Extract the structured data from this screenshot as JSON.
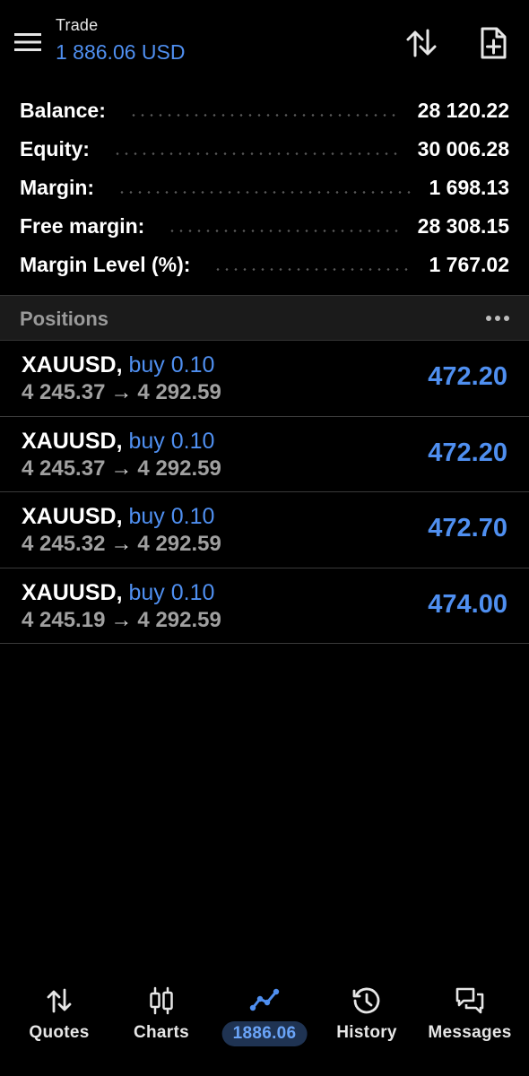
{
  "header": {
    "title": "Trade",
    "subtitle": "1 886.06 USD"
  },
  "summary": [
    {
      "label": "Balance:",
      "value": "28 120.22"
    },
    {
      "label": "Equity:",
      "value": "30 006.28"
    },
    {
      "label": "Margin:",
      "value": "1 698.13"
    },
    {
      "label": "Free margin:",
      "value": "28 308.15"
    },
    {
      "label": "Margin Level (%):",
      "value": "1 767.02"
    }
  ],
  "positions": {
    "title": "Positions",
    "items": [
      {
        "symbol": "XAUUSD,",
        "type": "buy 0.10",
        "open": "4 245.37",
        "arrow": "→",
        "current": "4 292.59",
        "profit": "472.20"
      },
      {
        "symbol": "XAUUSD,",
        "type": "buy 0.10",
        "open": "4 245.37",
        "arrow": "→",
        "current": "4 292.59",
        "profit": "472.20"
      },
      {
        "symbol": "XAUUSD,",
        "type": "buy 0.10",
        "open": "4 245.32",
        "arrow": "→",
        "current": "4 292.59",
        "profit": "472.70"
      },
      {
        "symbol": "XAUUSD,",
        "type": "buy 0.10",
        "open": "4 245.19",
        "arrow": "→",
        "current": "4 292.59",
        "profit": "474.00"
      }
    ]
  },
  "nav": {
    "quotes": "Quotes",
    "charts": "Charts",
    "trade": "1886.06",
    "history": "History",
    "messages": "Messages"
  },
  "colors": {
    "accent": "#4f8ff0",
    "background": "#000000",
    "section_header": "#1b1b1b",
    "active_pill": "#1f3352"
  },
  "icons": {
    "menu": "hamburger-menu-icon",
    "sort": "sort-arrows-icon",
    "new_document": "new-document-icon",
    "more": "more-dots-icon",
    "quotes": "up-down-arrows-icon",
    "charts": "candlestick-icon",
    "trade": "trend-line-icon",
    "history": "history-clock-icon",
    "messages": "chat-bubbles-icon"
  }
}
